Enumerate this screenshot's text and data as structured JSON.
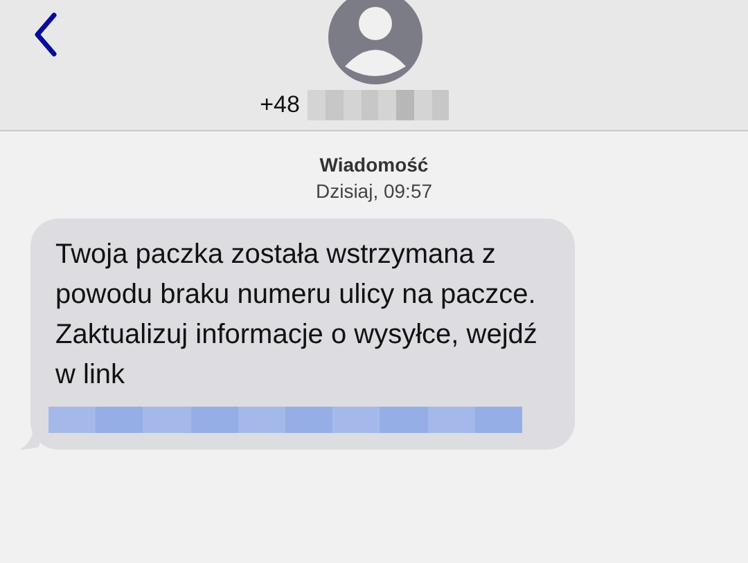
{
  "header": {
    "phone_prefix": "+48"
  },
  "message_meta": {
    "label": "Wiadomość",
    "time": "Dzisiaj, 09:57"
  },
  "message": {
    "text": "Twoja paczka została wstrzymana z powodu braku numeru ulicy na paczce. Zaktualizuj informacje o wysyłce, wejdź w link"
  }
}
